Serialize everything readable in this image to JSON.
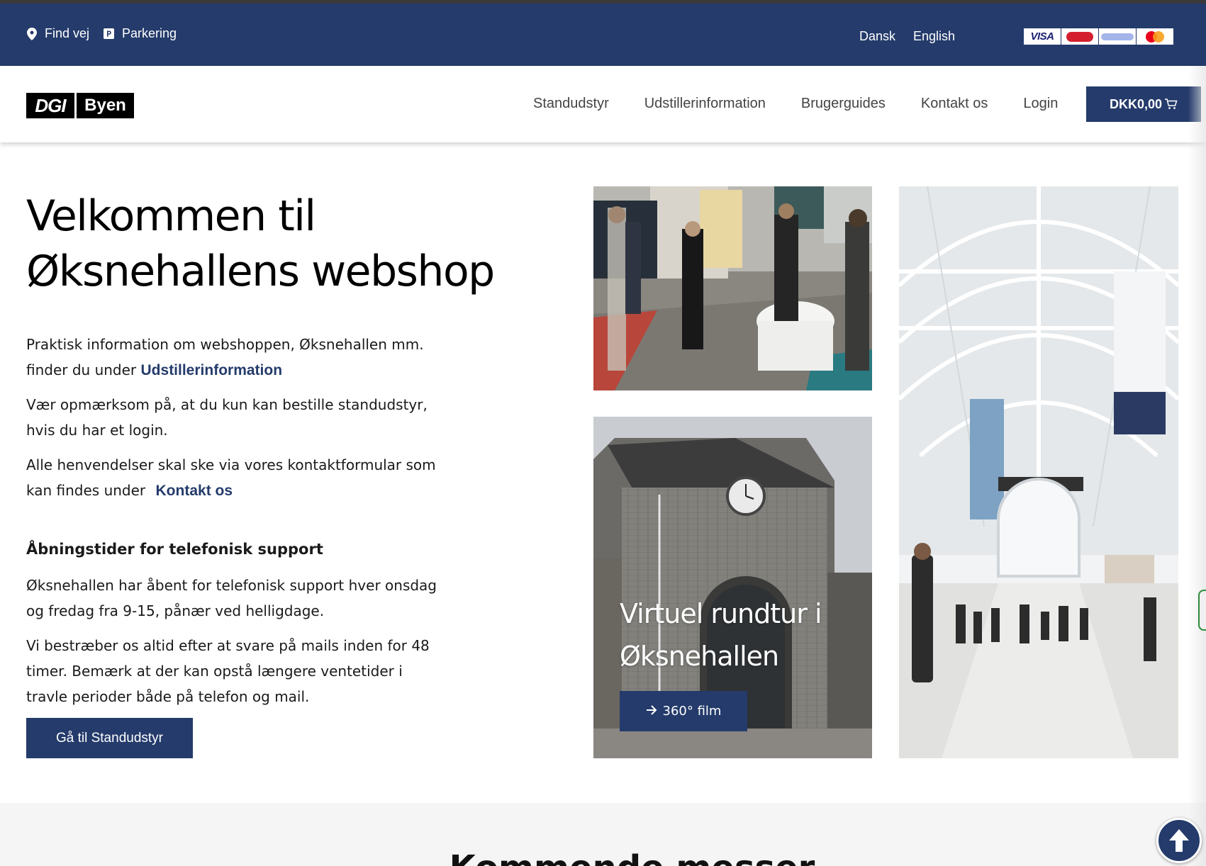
{
  "topbar": {
    "find_way": "Find vej",
    "parking": "Parkering",
    "lang_dansk": "Dansk",
    "lang_english": "English",
    "cards": {
      "visa": "VISA"
    },
    "bg_color": "#243b6b"
  },
  "header": {
    "logo_dgi": "DGI",
    "logo_byen": "Byen",
    "nav": [
      "Standudstyr",
      "Udstillerinformation",
      "Brugerguides",
      "Kontakt os",
      "Login"
    ],
    "cart_label": "DKK0,00"
  },
  "hero": {
    "title_line1": "Velkommen til",
    "title_line2": "Øksnehallens webshop",
    "p1_text": "Praktisk information om webshoppen, Øksnehallen mm. finder du under ",
    "p1_link": "Udstillerinformation",
    "p2_text": "Vær opmærksom på, at du kun kan bestille standudstyr, hvis du har et login.",
    "p3_text": "Alle henvendelser skal ske via vores kontaktformular som kan findes under ",
    "p3_link": "Kontakt os",
    "subhead": "Åbningstider for telefonisk support",
    "p4_text": "Øksnehallen har åbent for telefonisk support hver onsdag og fredag fra 9-15, pånær ved helligdage.",
    "p5_text": "Vi bestræber os altid efter at svare på mails inden for 48 timer. Bemærk at der kan opstå længere ventetider i travle perioder både på telefon og mail.",
    "cta": "Gå til Standudstyr"
  },
  "tour": {
    "title_line1": "Virtuel rundtur i",
    "title_line2": "Øksnehallen",
    "button": "360° film"
  },
  "upcoming": {
    "title": "Kommende messer"
  },
  "colors": {
    "brand": "#243b6b",
    "link": "#243b6b"
  }
}
